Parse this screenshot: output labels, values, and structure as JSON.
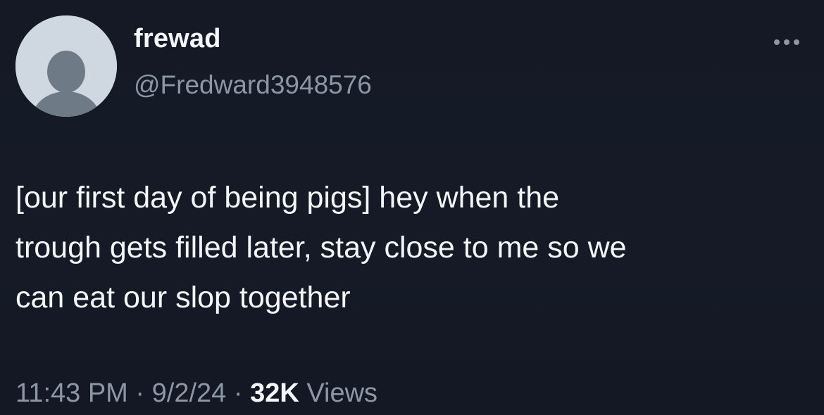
{
  "tweet": {
    "author": {
      "display_name": "frewad",
      "handle": "@Fredward3948576"
    },
    "text": "[our first day of being pigs]  hey when the\ntrough gets filled later, stay close to me so we\ncan eat our slop together",
    "time": "11:43 PM",
    "separator": " · ",
    "date": "9/2/24",
    "views_count": "32K",
    "views_label": "Views"
  },
  "icons": {
    "avatar": "default-profile-icon",
    "more": "more-options-icon"
  },
  "colors": {
    "background": "#151a26",
    "primary_text": "#f4f6f8",
    "secondary_text": "#8c97a3",
    "avatar_bg": "#cfd8e0",
    "avatar_figure": "#6e7b87"
  }
}
